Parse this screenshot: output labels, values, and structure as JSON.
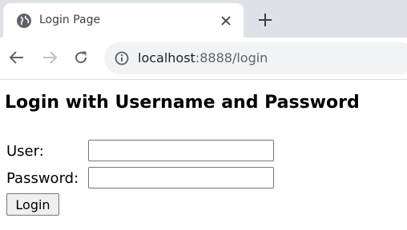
{
  "browser": {
    "tab": {
      "title": "Login Page"
    },
    "address_bar": {
      "host": "localhost",
      "rest": ":8888/login"
    }
  },
  "page": {
    "heading": "Login with Username and Password",
    "form": {
      "user_label": "User:",
      "user_value": "",
      "password_label": "Password:",
      "password_value": "",
      "submit_label": "Login"
    }
  }
}
